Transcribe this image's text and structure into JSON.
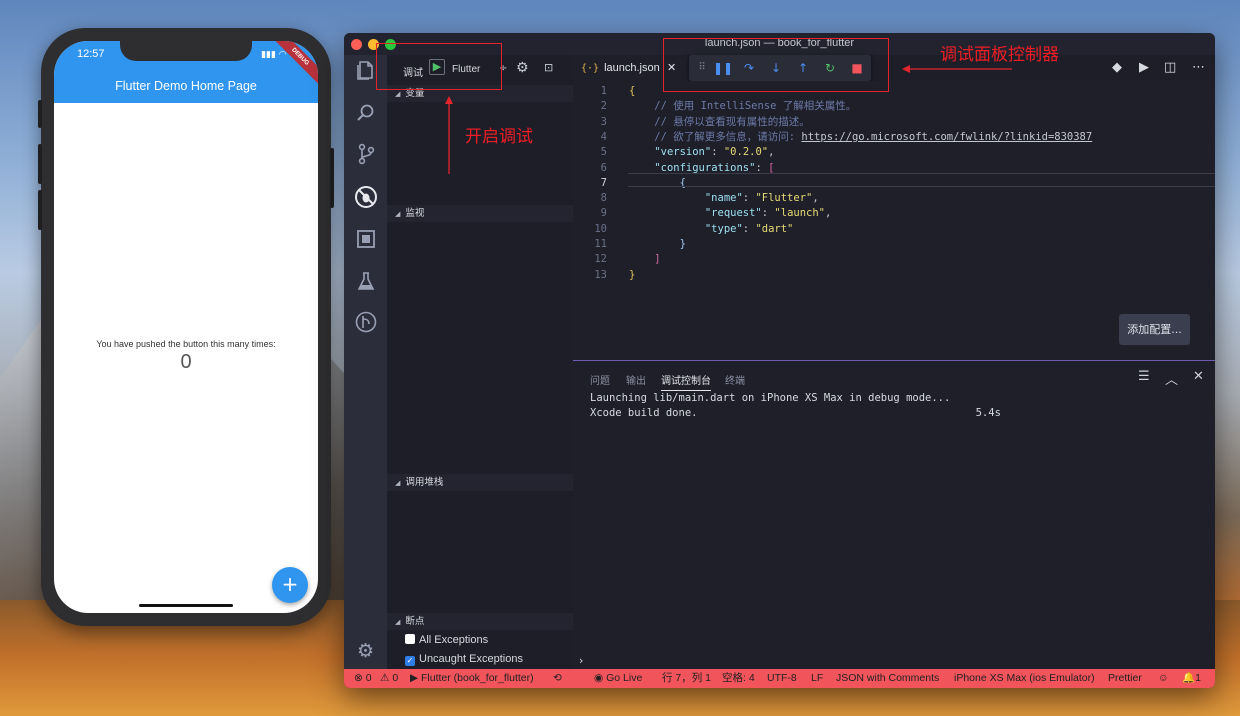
{
  "phone": {
    "time": "12:57",
    "signal": "📶",
    "debug_banner": "DEBUG",
    "appbar_title": "Flutter Demo Home Page",
    "counter_text": "You have pushed the button this many times:",
    "counter_value": "0",
    "fab_icon": "+"
  },
  "window": {
    "title": "launch.json — book_for_flutter"
  },
  "debug_toolbar": {
    "label": "调试",
    "config": "Flutter",
    "more": "÷"
  },
  "sidebar": {
    "sections": {
      "variables": "变量",
      "watch": "监视",
      "call_stack": "调用堆栈",
      "breakpoints": "断点"
    },
    "breakpoints": [
      {
        "label": "All Exceptions",
        "checked": false
      },
      {
        "label": "Uncaught Exceptions",
        "checked": true
      }
    ]
  },
  "editor": {
    "tab_label": "launch.json",
    "tab_icon": "{·}",
    "add_config_label": "添加配置...",
    "lines": [
      {
        "n": "1",
        "html": "<span class=\"c-brk\">{</span>"
      },
      {
        "n": "2",
        "html": "    <span class=\"c-com\">// 使用 IntelliSense 了解相关属性。</span>"
      },
      {
        "n": "3",
        "html": "    <span class=\"c-com\">// 悬停以查看现有属性的描述。</span>"
      },
      {
        "n": "4",
        "html": "    <span class=\"c-com\">// 欲了解更多信息，请访问: </span><span class=\"c-url\">https://go.microsoft.com/fwlink/?linkid=830387</span>"
      },
      {
        "n": "5",
        "html": "    <span class=\"c-key\">\"version\"</span><span class=\"c-pun\">: </span><span class=\"c-str\">\"0.2.0\"</span><span class=\"c-pun\">,</span>"
      },
      {
        "n": "6",
        "html": "    <span class=\"c-key\">\"configurations\"</span><span class=\"c-pun\">: </span><span class=\"c-brk2\">[</span>"
      },
      {
        "n": "7",
        "html": "        <span class=\"c-prop\">{</span>"
      },
      {
        "n": "8",
        "html": "            <span class=\"c-key\">\"name\"</span><span class=\"c-pun\">: </span><span class=\"c-str\">\"Flutter\"</span><span class=\"c-pun\">,</span>"
      },
      {
        "n": "9",
        "html": "            <span class=\"c-key\">\"request\"</span><span class=\"c-pun\">: </span><span class=\"c-str\">\"launch\"</span><span class=\"c-pun\">,</span>"
      },
      {
        "n": "10",
        "html": "            <span class=\"c-key\">\"type\"</span><span class=\"c-pun\">: </span><span class=\"c-str\">\"dart\"</span>"
      },
      {
        "n": "11",
        "html": "        <span class=\"c-prop\">}</span>"
      },
      {
        "n": "12",
        "html": "    <span class=\"c-brk2\">]</span>"
      },
      {
        "n": "13",
        "html": "<span class=\"c-brk\">}</span>"
      }
    ],
    "current_line": "7"
  },
  "panel": {
    "tabs": [
      "问题",
      "输出",
      "调试控制台",
      "终端"
    ],
    "active_tab": "调试控制台",
    "console_lines": [
      "Launching lib/main.dart on iPhone XS Max in debug mode...",
      "Xcode build done.                                            5.4s"
    ],
    "prompt": "›"
  },
  "statusbar": {
    "errors": "⊗ 0",
    "warnings": "⚠ 0",
    "run_config": "▶ Flutter (book_for_flutter)",
    "sync_icon": "⟲",
    "go_live": "Go Live",
    "cursor": "行 7，列 1",
    "spaces": "空格: 4",
    "encoding": "UTF-8",
    "eol": "LF",
    "language": "JSON with Comments",
    "device": "iPhone XS Max (ios Emulator)",
    "formatter": "Prettier",
    "smiley": "☺",
    "notifications": "🔔1"
  },
  "annotations": {
    "start_debug": "开启调试",
    "debug_panel_controller": "调试面板控制器"
  },
  "colors": {
    "accent_blue": "#2f95ef",
    "statusbar": "#f2545b",
    "annotation_red": "#e5232b"
  }
}
